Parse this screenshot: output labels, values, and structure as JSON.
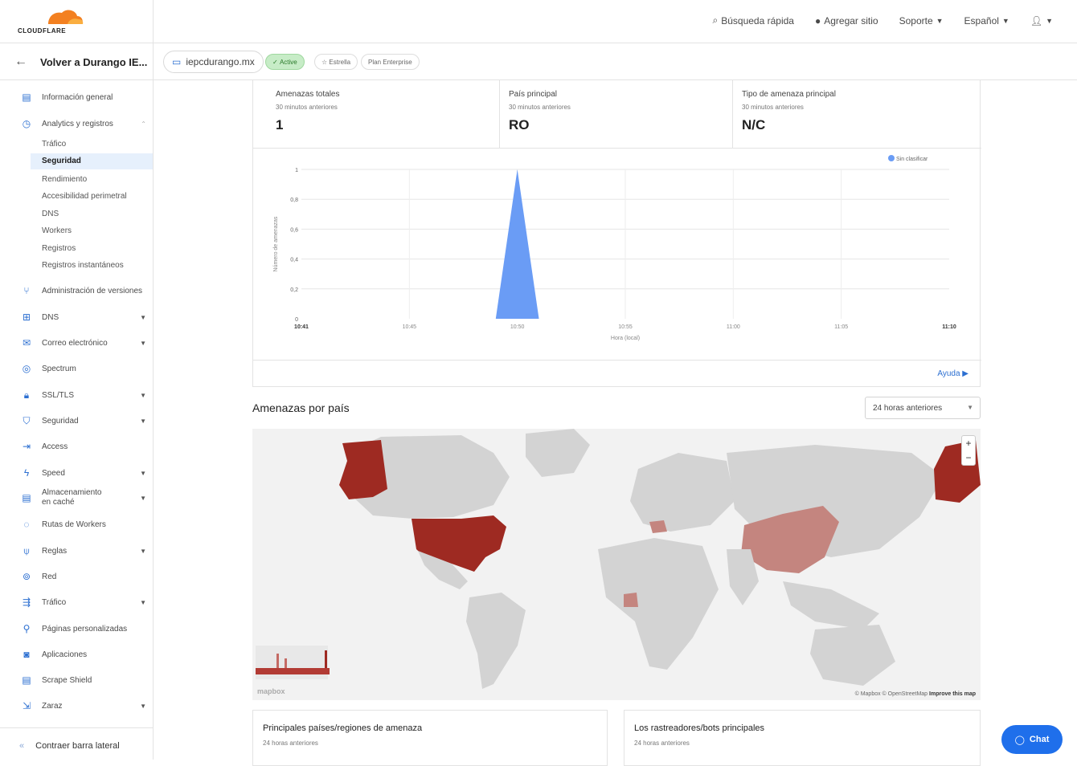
{
  "header": {
    "logo_text": "CLOUDFLARE",
    "search": "Búsqueda rápida",
    "add_site": "Agregar sitio",
    "support": "Soporte",
    "language": "Español"
  },
  "subheader": {
    "back_label": "Volver a Durango IE...",
    "domain": "iepcdurango.mx",
    "status": "Active",
    "star": "Estrella",
    "plan": "Plan Enterprise"
  },
  "sidebar": {
    "items": [
      {
        "label": "Información general",
        "icon": "document-icon"
      },
      {
        "label": "Analytics y registros",
        "icon": "clock-icon"
      },
      {
        "label": "Administración de versiones",
        "icon": "branch-icon"
      },
      {
        "label": "DNS",
        "icon": "network-icon"
      },
      {
        "label": "Correo electrónico",
        "icon": "mail-icon"
      },
      {
        "label": "Spectrum",
        "icon": "spectrum-icon"
      },
      {
        "label": "SSL/TLS",
        "icon": "lock-icon"
      },
      {
        "label": "Seguridad",
        "icon": "shield-icon"
      },
      {
        "label": "Access",
        "icon": "access-icon"
      },
      {
        "label": "Speed",
        "icon": "bolt-icon"
      },
      {
        "label": "Almacenamiento en caché",
        "icon": "cache-icon"
      },
      {
        "label": "Rutas de Workers",
        "icon": "workers-icon"
      },
      {
        "label": "Reglas",
        "icon": "rules-icon"
      },
      {
        "label": "Red",
        "icon": "location-icon"
      },
      {
        "label": "Tráfico",
        "icon": "traffic-icon"
      },
      {
        "label": "Páginas personalizadas",
        "icon": "wrench-icon"
      },
      {
        "label": "Aplicaciones",
        "icon": "apps-icon"
      },
      {
        "label": "Scrape Shield",
        "icon": "scrape-icon"
      },
      {
        "label": "Zaraz",
        "icon": "zaraz-icon"
      }
    ],
    "analytics_sub": [
      "Tráfico",
      "Seguridad",
      "Rendimiento",
      "Accesibilidad perimetral",
      "DNS",
      "Workers",
      "Registros",
      "Registros instantáneos"
    ],
    "collapse": "Contraer barra lateral"
  },
  "stats": [
    {
      "title": "Amenazas totales",
      "subtitle": "30 minutos anteriores",
      "value": "1"
    },
    {
      "title": "País principal",
      "subtitle": "30 minutos anteriores",
      "value": "RO"
    },
    {
      "title": "Tipo de amenaza principal",
      "subtitle": "30 minutos anteriores",
      "value": "N/C"
    }
  ],
  "chart_data": {
    "type": "area",
    "x": [
      "10:41",
      "10:45",
      "10:50",
      "10:55",
      "11:00",
      "11:05",
      "11:10"
    ],
    "series": [
      {
        "name": "Sin clasificar",
        "color": "#6a9cf5",
        "values": [
          0,
          0,
          1,
          0,
          0,
          0,
          0
        ]
      }
    ],
    "y_ticks": [
      "0",
      "0,2",
      "0,4",
      "0,6",
      "0,8",
      "1"
    ],
    "xlabel": "Hora (local)",
    "ylabel": "Número de amenazas",
    "ylim": [
      0,
      1
    ],
    "legend_position": "top-right",
    "grid": true
  },
  "help": "Ayuda ▶",
  "map_section": {
    "title": "Amenazas por país",
    "range": "24 horas anteriores",
    "attribution": "© Mapbox © OpenStreetMap",
    "improve": "Improve this map",
    "mapbox": "mapbox"
  },
  "cards": [
    {
      "title": "Principales países/regiones de amenaza",
      "subtitle": "24 horas anteriores"
    },
    {
      "title": "Los rastreadores/bots principales",
      "subtitle": "24 horas anteriores"
    }
  ],
  "chat": "Chat"
}
